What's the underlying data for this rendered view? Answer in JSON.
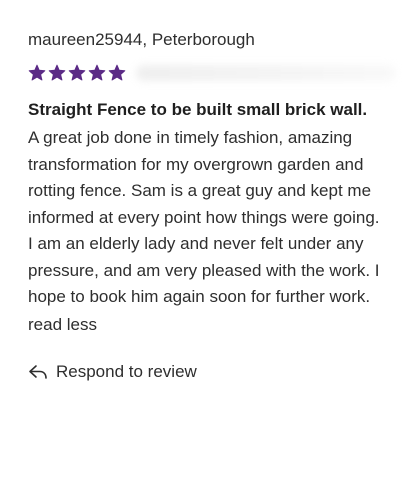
{
  "review": {
    "reviewer": "maureen25944, Peterborough",
    "rating": 5,
    "rating_max": 5,
    "star_color": "#5b2a86",
    "title": "Straight Fence to be built small brick wall.",
    "body": "A great job done in timely fashion, amazing transformation for my overgrown garden and rotting fence. Sam is a great guy and kept me informed at every point how things were going. I am an elderly lady and never felt under any pressure, and am very pleased with the work. I hope to book him again soon for further work.",
    "read_less_label": "read less",
    "respond_label": "Respond to review",
    "respond_icon": "reply-arrow-icon"
  }
}
